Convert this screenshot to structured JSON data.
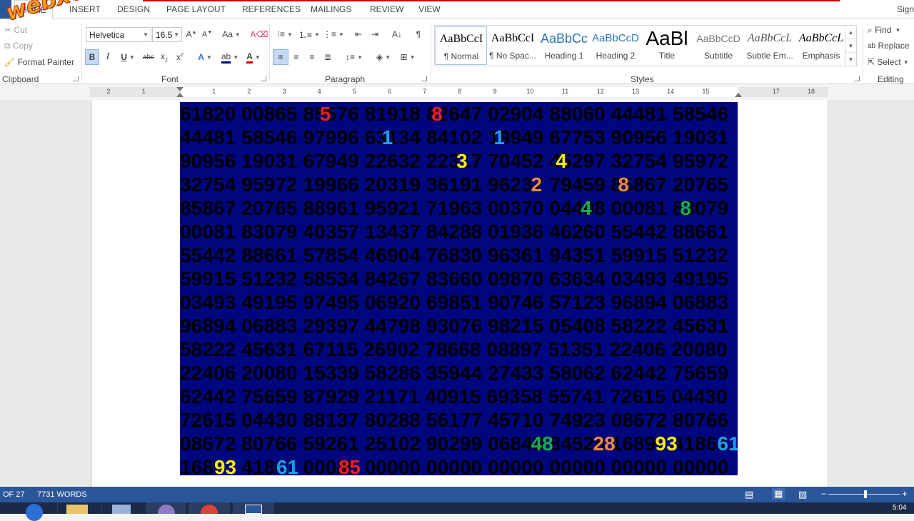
{
  "tabs": [
    {
      "label": "HOME",
      "active": true
    },
    {
      "label": "INSERT"
    },
    {
      "label": "DESIGN"
    },
    {
      "label": "PAGE LAYOUT"
    },
    {
      "label": "REFERENCES"
    },
    {
      "label": "MAILINGS"
    },
    {
      "label": "REVIEW"
    },
    {
      "label": "VIEW"
    }
  ],
  "signin": "Sign",
  "watermark": "webxoso.net",
  "clipboard": {
    "cut": "Cut",
    "copy": "Copy",
    "format_painter": "Format Painter",
    "label": "Clipboard"
  },
  "font": {
    "name": "Helvetica",
    "size": "16.5",
    "label": "Font"
  },
  "paragraph": {
    "label": "Paragraph"
  },
  "styles": {
    "label": "Styles",
    "items": [
      {
        "preview": "AaBbCcI",
        "name": "¶ Normal"
      },
      {
        "preview": "AaBbCcI",
        "name": "¶ No Spac..."
      },
      {
        "preview": "AaBbCc",
        "name": "Heading 1"
      },
      {
        "preview": "AaBbCcD",
        "name": "Heading 2"
      },
      {
        "preview": "AaBl",
        "name": "Title"
      },
      {
        "preview": "AaBbCcD",
        "name": "Subtitle"
      },
      {
        "preview": "AaBbCcL",
        "name": "Subtle Em..."
      },
      {
        "preview": "AaBbCcL",
        "name": "Emphasis"
      }
    ]
  },
  "editing": {
    "find": "Find",
    "replace": "Replace",
    "select": "Select",
    "label": "Editing"
  },
  "ruler_numbers": [
    "2",
    "1",
    "",
    "1",
    "2",
    "3",
    "4",
    "5",
    "6",
    "7",
    "8",
    "9",
    "10",
    "11",
    "12",
    "13",
    "14",
    "15",
    "",
    "17",
    "18"
  ],
  "document": {
    "lines": [
      "61820 00865 85576 81918 82647 02904 88060 44481 58546",
      "44481 58546 97996 63134 84102 19949 67753 90956 19031",
      "90956 19031 67949 22632 22317 70452 45297 32754 95972",
      "32754 95972 19966 20319 36191 96237 79459 85867 20765",
      "85867 20765 88961 95921 71963 00370 04408 00081 83079",
      "00081 83079 40357 13437 84288 01936 46260 55442 88661",
      "55442 88661 57854 46904 76830 96361 94351 59915 51232",
      "59915 51232 58534 84267 83660 09870 63634 03493 49195",
      "03493 49195 97495 06920 69851 90746 57123 96894 06883",
      "96894 06883 29397 44798 93076 98215 05408 58222 45631",
      "58222 45631 67115 26902 78668 08897 51351 22406 20080",
      "22406 20080 15339 58286 35944 27433 58062 62442 75659",
      "62442 75659 87929 21171 40915 69358 55741 72615 04430",
      "72615 04430 88137 80288 56177 45710 74923 08672 80766",
      "08672 80766 59261 25102 90299 06848 84528 16893 41861",
      "16893 41861 00085 00000 00000 00000 00000 00000 00000"
    ],
    "highlights": [
      {
        "text": "5",
        "color": "#ff1a1a",
        "row": 0,
        "col": 2.25
      },
      {
        "text": "8",
        "color": "#ff1a1a",
        "row": 0,
        "col": 4.05
      },
      {
        "text": "1",
        "color": "#1ea0e6",
        "row": 1,
        "col": 3.25
      },
      {
        "text": "1",
        "color": "#1ea0e6",
        "row": 1,
        "col": 5.05
      },
      {
        "text": "3",
        "color": "#ffee00",
        "row": 2,
        "col": 4.45
      },
      {
        "text": "4",
        "color": "#ffee00",
        "row": 2,
        "col": 6.05
      },
      {
        "text": "2",
        "color": "#f0883a",
        "row": 3,
        "col": 5.65
      },
      {
        "text": "8",
        "color": "#f0883a",
        "row": 3,
        "col": 7.05
      },
      {
        "text": "4",
        "color": "#17b04a",
        "row": 4,
        "col": 6.45
      },
      {
        "text": "8",
        "color": "#17b04a",
        "row": 4,
        "col": 8.05
      },
      {
        "text": "48",
        "color": "#17b04a",
        "row": 14,
        "col": 5.65
      },
      {
        "text": "28",
        "color": "#f0883a",
        "row": 14,
        "col": 6.65
      },
      {
        "text": "93",
        "color": "#ffee00",
        "row": 14,
        "col": 7.65
      },
      {
        "text": "61",
        "color": "#1ea0e6",
        "row": 14,
        "col": 8.65
      },
      {
        "text": "93",
        "color": "#ffee00",
        "row": 15,
        "col": 0.55
      },
      {
        "text": "61",
        "color": "#1ea0e6",
        "row": 15,
        "col": 1.55
      },
      {
        "text": "85",
        "color": "#ff1a1a",
        "row": 15,
        "col": 2.55
      }
    ]
  },
  "status": {
    "page": "OF 27",
    "words": "7731 WORDS",
    "time": "5:04"
  }
}
